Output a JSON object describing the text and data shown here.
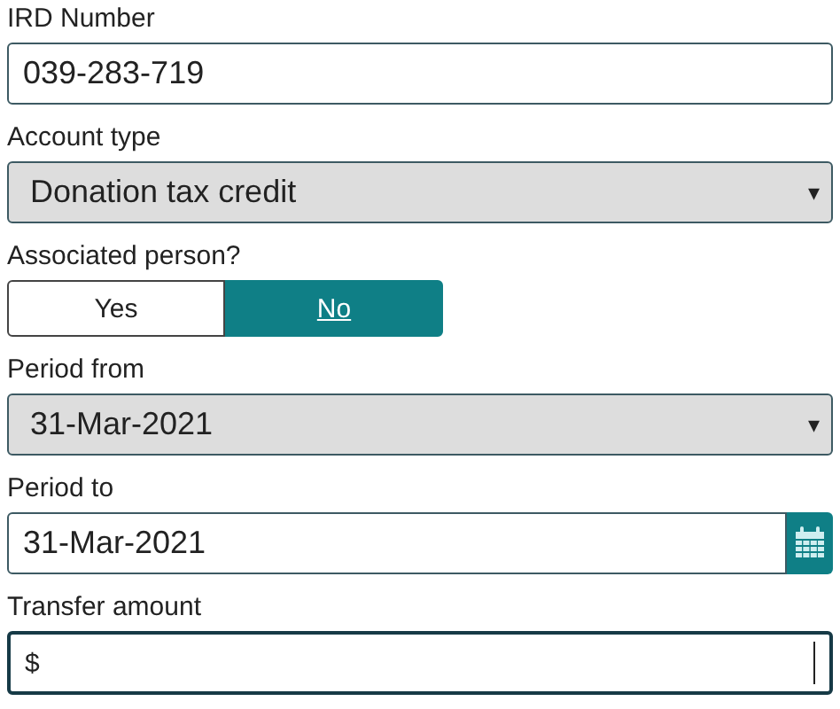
{
  "fields": [
    {
      "kind": "text",
      "label": "IRD Number",
      "value": "039-283-719"
    },
    {
      "kind": "select",
      "label": "Account type",
      "value": "Donation tax credit",
      "arrow": "▾"
    },
    {
      "kind": "toggle",
      "label": "Associated person?",
      "options": [
        {
          "label": "Yes",
          "selected": false
        },
        {
          "label": "No",
          "selected": true
        }
      ]
    },
    {
      "kind": "select",
      "label": "Period from",
      "value": "31-Mar-2021",
      "arrow": "▾"
    },
    {
      "kind": "date",
      "label": "Period to",
      "value": "31-Mar-2021"
    },
    {
      "kind": "currency",
      "label": "Transfer amount",
      "prefix": "$",
      "focused": true
    }
  ]
}
